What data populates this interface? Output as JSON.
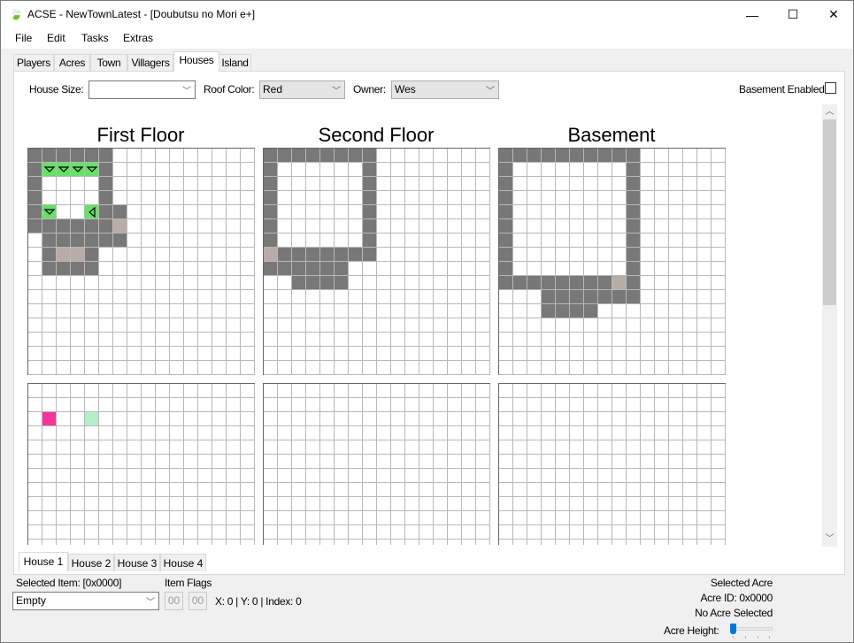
{
  "window": {
    "title": "ACSE - NewTownLatest - [Doubutsu no Mori e+]",
    "icon": "app-leaf-icon",
    "controls": {
      "minimize": "—",
      "maximize": "☐",
      "close": "✕"
    }
  },
  "menu": [
    "File",
    "Edit",
    "Tasks",
    "Extras"
  ],
  "tabs": [
    {
      "label": "Players",
      "active": false
    },
    {
      "label": "Acres",
      "active": false
    },
    {
      "label": "Town",
      "active": false
    },
    {
      "label": "Villagers",
      "active": false
    },
    {
      "label": "Houses",
      "active": true
    },
    {
      "label": "Island",
      "active": false
    }
  ],
  "houses": {
    "house_size_label": "House Size:",
    "house_size_value": "",
    "roof_color_label": "Roof Color:",
    "roof_color_value": "Red",
    "owner_label": "Owner:",
    "owner_value": "Wes",
    "basement_label": "Basement Enabled",
    "basement_enabled": false,
    "floors": [
      {
        "title": "First Floor",
        "layout": [
          "DDDDDD",
          "DGGGGD",
          "DWWWWD",
          "DWWWWD",
          "DGWWLDD",
          "DDDDDDB",
          "WDDDDDD",
          "WDBBD",
          "WDDDD"
        ],
        "items_layout": [
          "",
          "",
          "WPWWM"
        ]
      },
      {
        "title": "Second Floor",
        "layout": [
          "DDDDDDDD",
          "DWWWWWWD",
          "DWWWWWWD",
          "DWWWWWWD",
          "DWWWWWWD",
          "DWWWWWWD",
          "DWWWWWWD",
          "BDDDDDDD",
          "DDDDDD",
          "WWDDDD"
        ],
        "items_layout": []
      },
      {
        "title": "Basement",
        "layout": [
          "DDDDDDDDDD",
          "DWWWWWWWWD",
          "DWWWWWWWWD",
          "DWWWWWWWWD",
          "DWWWWWWWWD",
          "DWWWWWWWWD",
          "DWWWWWWWWD",
          "DWWWWWWWWD",
          "DWWWWWWWWD",
          "DDDDDDDDBD",
          "WWWDDDDDDD",
          "WWWDDDD"
        ],
        "items_layout": []
      }
    ],
    "green_cell_arrows": {
      "1,1": "down",
      "1,2": "down",
      "1,3": "down",
      "1,4": "down",
      "4,1": "down",
      "4,4": "left"
    },
    "colors": {
      "wall": "#787878",
      "door": "#b8aca8",
      "furniture": "#66e066",
      "item_pink": "#f4369a",
      "item_mint": "#b6eec8"
    },
    "house_tabs": [
      {
        "label": "House 1",
        "active": true
      },
      {
        "label": "House 2",
        "active": false
      },
      {
        "label": "House 3",
        "active": false
      },
      {
        "label": "House 4",
        "active": false
      }
    ]
  },
  "status": {
    "selected_item_label": "Selected Item: [0x0000]",
    "item_value": "Empty",
    "item_flags_label": "Item Flags",
    "flag1": "00",
    "flag2": "00",
    "position": "X: 0 | Y: 0 | Index: 0",
    "selected_acre_label": "Selected Acre",
    "acre_id": "Acre ID: 0x0000",
    "acre_selection": "No Acre Selected",
    "acre_height_label": "Acre Height:",
    "acre_height_value": 0
  }
}
